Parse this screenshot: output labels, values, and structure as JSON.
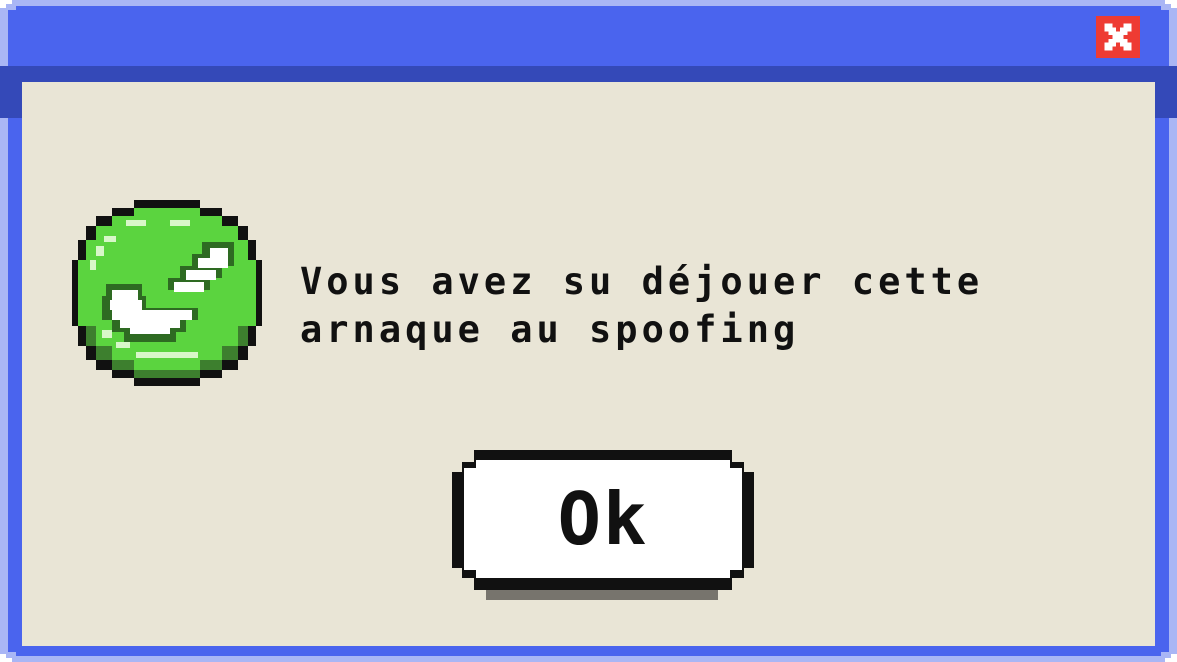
{
  "dialog": {
    "message": "Vous avez su déjouer cette arnaque au spoofing",
    "ok_label": "Ok"
  },
  "icons": {
    "close": "close-icon",
    "success": "checkmark-success-icon"
  },
  "colors": {
    "frame": "#4a64ee",
    "frame_light": "#a9b6f5",
    "title_shadow": "#3449b8",
    "content_bg": "#e9e5d6",
    "close_bg": "#ee3b33",
    "check_green": "#5bd43f",
    "button_face": "#ffffff"
  }
}
